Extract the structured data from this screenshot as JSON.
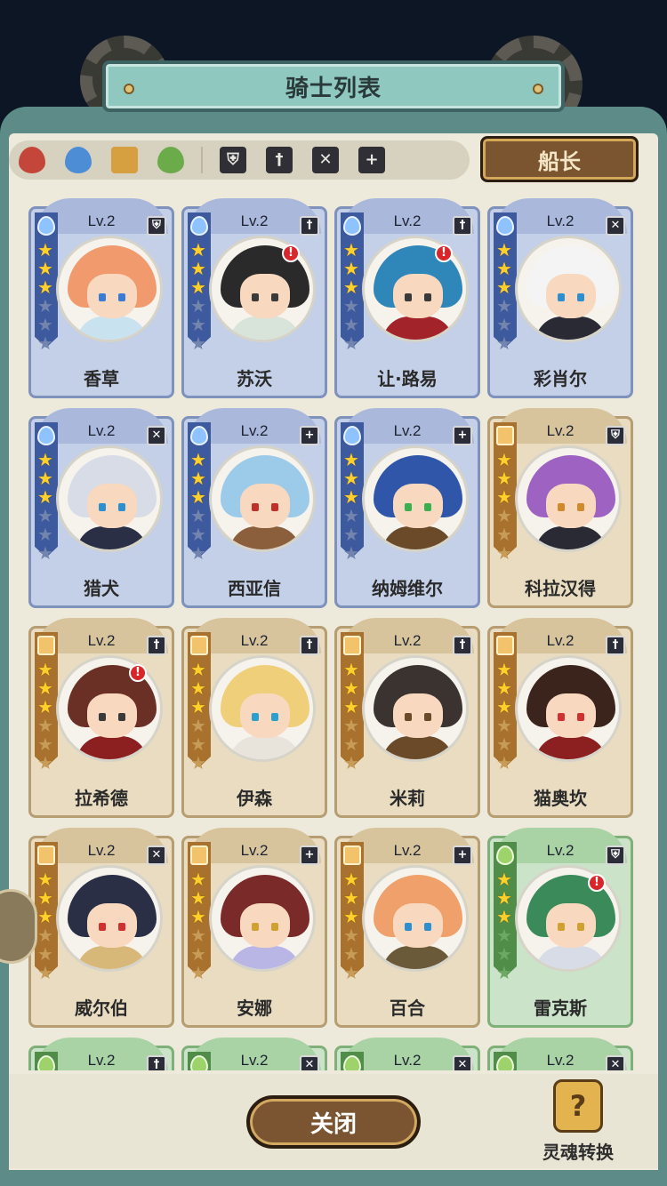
{
  "title": "骑士列表",
  "captain_label": "船长",
  "close_label": "关闭",
  "soul_label": "灵魂转换",
  "soul_icon_glyph": "?",
  "filters": {
    "elements": [
      "fire-icon",
      "water-icon",
      "earth-icon",
      "wind-icon"
    ],
    "roles": [
      {
        "icon": "shield-icon",
        "glyph": "⛨"
      },
      {
        "icon": "sword-icon",
        "glyph": "†"
      },
      {
        "icon": "bow-icon",
        "glyph": "✕"
      },
      {
        "icon": "heal-icon",
        "glyph": "+"
      }
    ]
  },
  "colors": {
    "blue_frame": "#c4cfe8",
    "gold_frame": "#e9dcc0",
    "green_frame": "#cbe3c8",
    "accent_teal": "#5d8c88",
    "button_brown": "#7b5531"
  },
  "knights": [
    {
      "name": "香草",
      "level": "Lv.2",
      "element": "water",
      "role": "shield",
      "role_glyph": "⛨",
      "stars": 3,
      "alert": false,
      "hair": "#f09a6e",
      "body": "#c9e2ef",
      "eyes": "#3a7bd5"
    },
    {
      "name": "苏沃",
      "level": "Lv.2",
      "element": "water",
      "role": "sword",
      "role_glyph": "†",
      "stars": 3,
      "alert": true,
      "hair": "#2a2a2a",
      "body": "#d8e4da",
      "eyes": "#3a3a3a"
    },
    {
      "name": "让·路易",
      "level": "Lv.2",
      "element": "water",
      "role": "sword",
      "role_glyph": "†",
      "stars": 3,
      "alert": true,
      "hair": "#2f86b8",
      "body": "#a2242a",
      "eyes": "#3a3a3a"
    },
    {
      "name": "彩肖尔",
      "level": "Lv.2",
      "element": "water",
      "role": "bow",
      "role_glyph": "✕",
      "stars": 3,
      "alert": false,
      "hair": "#f4f4f4",
      "body": "#2a2a35",
      "eyes": "#2b8fd0"
    },
    {
      "name": "猎犬",
      "level": "Lv.2",
      "element": "water",
      "role": "bow",
      "role_glyph": "✕",
      "stars": 3,
      "alert": false,
      "hair": "#d8dce6",
      "body": "#2b2f45",
      "eyes": "#2b8fd0"
    },
    {
      "name": "西亚信",
      "level": "Lv.2",
      "element": "water",
      "role": "heal",
      "role_glyph": "+",
      "stars": 3,
      "alert": false,
      "hair": "#9ccbea",
      "body": "#8b5e3c",
      "eyes": "#c0302a"
    },
    {
      "name": "纳姆维尔",
      "level": "Lv.2",
      "element": "water",
      "role": "heal",
      "role_glyph": "+",
      "stars": 3,
      "alert": false,
      "hair": "#2f56a8",
      "body": "#6b4a2a",
      "eyes": "#3bb050"
    },
    {
      "name": "科拉汉得",
      "level": "Lv.2",
      "element": "earth",
      "role": "shield",
      "role_glyph": "⛨",
      "stars": 3,
      "alert": false,
      "hair": "#9d62c2",
      "body": "#2a2a35",
      "eyes": "#d08a2b"
    },
    {
      "name": "拉希德",
      "level": "Lv.2",
      "element": "earth",
      "role": "sword",
      "role_glyph": "†",
      "stars": 3,
      "alert": true,
      "hair": "#6a2f25",
      "body": "#8c1f20",
      "eyes": "#3a3a3a"
    },
    {
      "name": "伊森",
      "level": "Lv.2",
      "element": "earth",
      "role": "sword",
      "role_glyph": "†",
      "stars": 3,
      "alert": false,
      "hair": "#efcf7a",
      "body": "#e8e4dc",
      "eyes": "#2b9fd0"
    },
    {
      "name": "米莉",
      "level": "Lv.2",
      "element": "earth",
      "role": "sword",
      "role_glyph": "†",
      "stars": 3,
      "alert": false,
      "hair": "#3a3330",
      "body": "#6b4a2a",
      "eyes": "#6b4a2a"
    },
    {
      "name": "猫奥坎",
      "level": "Lv.2",
      "element": "earth",
      "role": "sword",
      "role_glyph": "†",
      "stars": 3,
      "alert": false,
      "hair": "#3a241c",
      "body": "#8c1f20",
      "eyes": "#d03030"
    },
    {
      "name": "威尔伯",
      "level": "Lv.2",
      "element": "earth",
      "role": "bow",
      "role_glyph": "✕",
      "stars": 3,
      "alert": false,
      "hair": "#2a2f45",
      "body": "#d8b878",
      "eyes": "#d03030"
    },
    {
      "name": "安娜",
      "level": "Lv.2",
      "element": "earth",
      "role": "heal",
      "role_glyph": "+",
      "stars": 3,
      "alert": false,
      "hair": "#7a2a28",
      "body": "#b9b6e6",
      "eyes": "#d0a030"
    },
    {
      "name": "百合",
      "level": "Lv.2",
      "element": "earth",
      "role": "heal",
      "role_glyph": "+",
      "stars": 3,
      "alert": false,
      "hair": "#f0a06a",
      "body": "#6b5a3a",
      "eyes": "#2b8fd0"
    },
    {
      "name": "雷克斯",
      "level": "Lv.2",
      "element": "wind",
      "role": "shield",
      "role_glyph": "⛨",
      "stars": 3,
      "alert": true,
      "hair": "#3a8a5a",
      "body": "#d8dce6",
      "eyes": "#d0a030"
    },
    {
      "name": "",
      "level": "Lv.2",
      "element": "wind",
      "role": "sword",
      "role_glyph": "†",
      "stars": 3,
      "alert": false,
      "hair": "#5a8a4a",
      "body": "#cccccc",
      "eyes": "#333333"
    },
    {
      "name": "",
      "level": "Lv.2",
      "element": "wind",
      "role": "bow",
      "role_glyph": "✕",
      "stars": 3,
      "alert": false,
      "hair": "#5a8a4a",
      "body": "#cccccc",
      "eyes": "#333333"
    },
    {
      "name": "",
      "level": "Lv.2",
      "element": "wind",
      "role": "bow",
      "role_glyph": "✕",
      "stars": 3,
      "alert": false,
      "hair": "#5a8a4a",
      "body": "#cccccc",
      "eyes": "#333333"
    },
    {
      "name": "",
      "level": "Lv.2",
      "element": "wind",
      "role": "bow",
      "role_glyph": "✕",
      "stars": 3,
      "alert": false,
      "hair": "#5a8a4a",
      "body": "#cccccc",
      "eyes": "#333333"
    }
  ]
}
